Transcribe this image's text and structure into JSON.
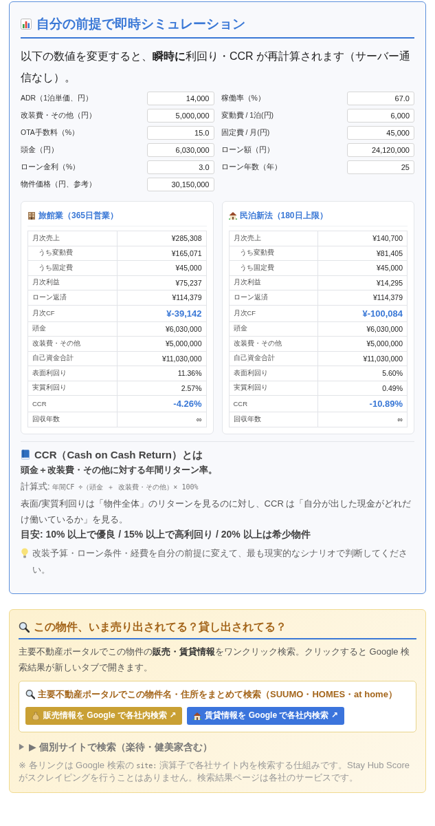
{
  "simulator": {
    "title": "自分の前提で即時シミュレーション",
    "intro": "以下の数値を変更すると、**瞬時に**利回り・CCR が再計算されます（サーバー通信なし）。",
    "fields": [
      {
        "label": "ADR（1泊単価、円）",
        "value": "14,000"
      },
      {
        "label": "稼働率（%）",
        "value": "67.0"
      },
      {
        "label": "改装費・その他（円）",
        "value": "5,000,000"
      },
      {
        "label": "変動費 / 1泊(円)",
        "value": "6,000"
      },
      {
        "label": "OTA手数料（%）",
        "value": "15.0"
      },
      {
        "label": "固定費 / 月(円)",
        "value": "45,000"
      },
      {
        "label": "頭金（円）",
        "value": "6,030,000"
      },
      {
        "label": "ローン額（円）",
        "value": "24,120,000"
      },
      {
        "label": "ローン金利（%）",
        "value": "3.0"
      },
      {
        "label": "ローン年数（年）",
        "value": "25"
      },
      {
        "label": "物件価格（円、参考）",
        "value": "30,150,000"
      }
    ],
    "scenarios": [
      {
        "kind": "ryokan",
        "title": "旅館業（365日営業）",
        "rows": [
          {
            "label": "月次売上",
            "value": "¥285,308",
            "kind": "main"
          },
          {
            "label": "うち変動費",
            "value": "¥165,071",
            "kind": "sub"
          },
          {
            "label": "うち固定費",
            "value": "¥45,000",
            "kind": "sub"
          },
          {
            "label": "月次利益",
            "value": "¥75,237",
            "kind": "main"
          },
          {
            "label": "ローン返済",
            "value": "¥114,379",
            "kind": "main"
          },
          {
            "label": "月次CF",
            "value": "¥-39,142",
            "kind": "highlight"
          },
          {
            "label": "頭金",
            "value": "¥6,030,000",
            "kind": "main"
          },
          {
            "label": "改装費・その他",
            "value": "¥5,000,000",
            "kind": "main"
          },
          {
            "label": "自己資金合計",
            "value": "¥11,030,000",
            "kind": "main"
          },
          {
            "label": "表面利回り",
            "value": "11.36%",
            "kind": "main"
          },
          {
            "label": "実質利回り",
            "value": "2.57%",
            "kind": "main"
          },
          {
            "label": "CCR",
            "value": "-4.26%",
            "kind": "highlight"
          },
          {
            "label": "回収年数",
            "value": "∞",
            "kind": "main"
          }
        ]
      },
      {
        "kind": "minpaku",
        "title": "民泊新法（180日上限）",
        "rows": [
          {
            "label": "月次売上",
            "value": "¥140,700",
            "kind": "main"
          },
          {
            "label": "うち変動費",
            "value": "¥81,405",
            "kind": "sub"
          },
          {
            "label": "うち固定費",
            "value": "¥45,000",
            "kind": "sub"
          },
          {
            "label": "月次利益",
            "value": "¥14,295",
            "kind": "main"
          },
          {
            "label": "ローン返済",
            "value": "¥114,379",
            "kind": "main"
          },
          {
            "label": "月次CF",
            "value": "¥-100,084",
            "kind": "highlight"
          },
          {
            "label": "頭金",
            "value": "¥6,030,000",
            "kind": "main"
          },
          {
            "label": "改装費・その他",
            "value": "¥5,000,000",
            "kind": "main"
          },
          {
            "label": "自己資金合計",
            "value": "¥11,030,000",
            "kind": "main"
          },
          {
            "label": "表面利回り",
            "value": "5.60%",
            "kind": "main"
          },
          {
            "label": "実質利回り",
            "value": "0.49%",
            "kind": "main"
          },
          {
            "label": "CCR",
            "value": "-10.89%",
            "kind": "highlight"
          },
          {
            "label": "回収年数",
            "value": "∞",
            "kind": "main"
          }
        ]
      }
    ],
    "ccr_info": {
      "title": "CCR（Cash on Cash Return）とは",
      "definition": "頭金＋改装費・その他に対する年間リターン率。",
      "formula_label": "計算式:",
      "formula": "年間CF ÷（頭金 ＋ 改装費・その他）× 100%",
      "explanation": "表面/実質利回りは「物件全体」のリターンを見るのに対し、CCR は「自分が出した現金がどれだけ働いているか」を見る。",
      "guideline": "目安: 10% 以上で優良 / 15% 以上で高利回り / 20% 以上は希少物件",
      "tip": "改装予算・ローン条件・経費を自分の前提に変えて、最も現実的なシナリオで判断してください。"
    }
  },
  "listing_search": {
    "title": "この物件、いま売り出されてる？貸し出されてる？",
    "intro": "主要不動産ポータルでこの物件の**販売・賃貸情報**をワンクリック検索。クリックすると Google 検索結果が新しいタブで開きます。",
    "portal_box": {
      "title": "主要不動産ポータルでこの物件名・住所をまとめて検索（SUUMO・HOMES・at home）",
      "buttons": [
        {
          "kind": "sale",
          "label": "販売情報を Google で各社内検索 ↗",
          "color": "#c9a034"
        },
        {
          "kind": "rent",
          "label": "賃貸情報を Google で各社内検索 ↗",
          "color": "#3b74dc"
        }
      ]
    },
    "individual_sites": {
      "label": "▶ 個別サイトで検索（楽待・健美家含む）",
      "expanded": false
    },
    "note": {
      "before": "※ 各リンクは Google 検索の",
      "code": "site:",
      "after": "演算子で各社サイト内を検索する仕組みです。Stay Hub Score がスクレイピングを行うことはありません。検索結果ページは各社のサービスです。"
    }
  }
}
